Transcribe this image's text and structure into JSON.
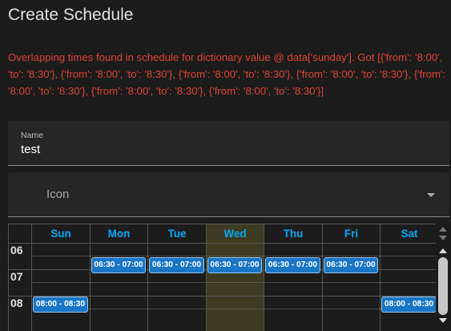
{
  "dialog": {
    "title": "Create Schedule",
    "error": "Overlapping times found in schedule for dictionary value @ data['sunday']. Got [{'from': '8:00', 'to': '8:30'}, {'from': '8:00', 'to': '8:30'}, {'from': '8:00', 'to': '8:30'}, {'from': '8:00', 'to': '8:30'}, {'from': '8:00', 'to': '8:30'}, {'from': '8:00', 'to': '8:30'}, {'from': '8:00', 'to': '8:30'}]"
  },
  "form": {
    "name_label": "Name",
    "name_value": "test",
    "icon_placeholder": "Icon"
  },
  "schedule": {
    "days": [
      "Sun",
      "Mon",
      "Tue",
      "Wed",
      "Thu",
      "Fri",
      "Sat"
    ],
    "hours": [
      "06",
      "07",
      "08"
    ],
    "events": [
      {
        "day": "Mon",
        "label": "06:30 - 07:00"
      },
      {
        "day": "Tue",
        "label": "06:30 - 07:00"
      },
      {
        "day": "Wed",
        "label": "06:30 - 07:00"
      },
      {
        "day": "Thu",
        "label": "06:30 - 07:00"
      },
      {
        "day": "Fri",
        "label": "06:30 - 07:00"
      },
      {
        "day": "Sun",
        "label": "08:00 - 08:30"
      },
      {
        "day": "Sat",
        "label": "08:00 - 08:30"
      }
    ],
    "today": "Wed"
  },
  "colors": {
    "accent": "#03a9f4",
    "error": "#db4437",
    "event": "#1976c7"
  }
}
